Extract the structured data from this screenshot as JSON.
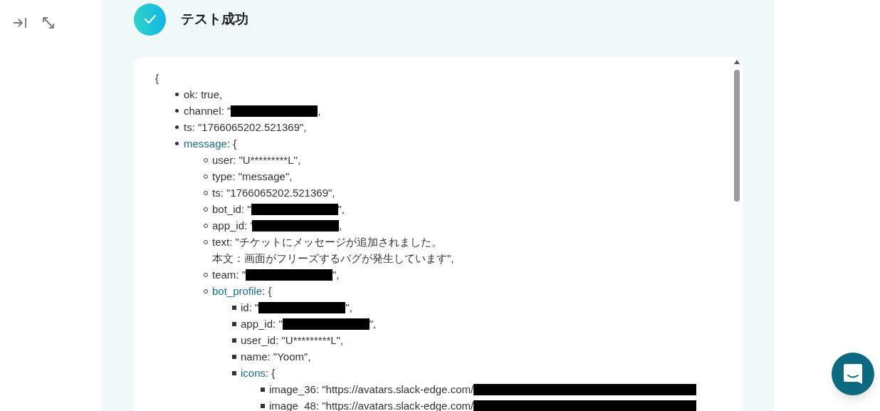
{
  "toolbar": {
    "icons": [
      {
        "kind": "dock"
      },
      {
        "kind": "expand"
      }
    ]
  },
  "result": {
    "title": "テスト成功",
    "open_brace": "{",
    "items": [
      {
        "text": "ok: true,"
      },
      {
        "text": "channel: \"",
        "redacted": true,
        "tail": ","
      },
      {
        "text": "ts: \"1766065202.521369\","
      },
      {
        "key": "message",
        "text": ": {",
        "children": [
          {
            "text": "user: \"U*********L\","
          },
          {
            "text": "type: \"message\","
          },
          {
            "text": "ts: \"1766065202.521369\","
          },
          {
            "text": "bot_id: \"",
            "redacted": true,
            "tail": "\","
          },
          {
            "text": "app_id: '",
            "redacted": true,
            "tail": ","
          },
          {
            "text": "text: \"チケットにメッセージが追加されました。",
            "continuation": "本文：画面がフリーズするバグが発生しています\","
          },
          {
            "text": "team: \"",
            "redacted": true,
            "tail": "\","
          },
          {
            "key": "bot_profile",
            "text": ": {",
            "children": [
              {
                "text": "id: \"",
                "redacted": true,
                "tail": "\","
              },
              {
                "text": "app_id: \"",
                "redacted": true,
                "tail": "\","
              },
              {
                "text": "user_id: \"U*********L\","
              },
              {
                "text": "name: \"Yoom\","
              },
              {
                "key": "icons",
                "text": ": {",
                "children": [
                  {
                    "text": "image_36: \"https://avatars.slack-edge.com/",
                    "redacted": true
                  },
                  {
                    "text": "image_48: \"https://avatars.slack-edge.com/",
                    "redacted": true
                  }
                ]
              }
            ]
          }
        ]
      }
    ]
  }
}
